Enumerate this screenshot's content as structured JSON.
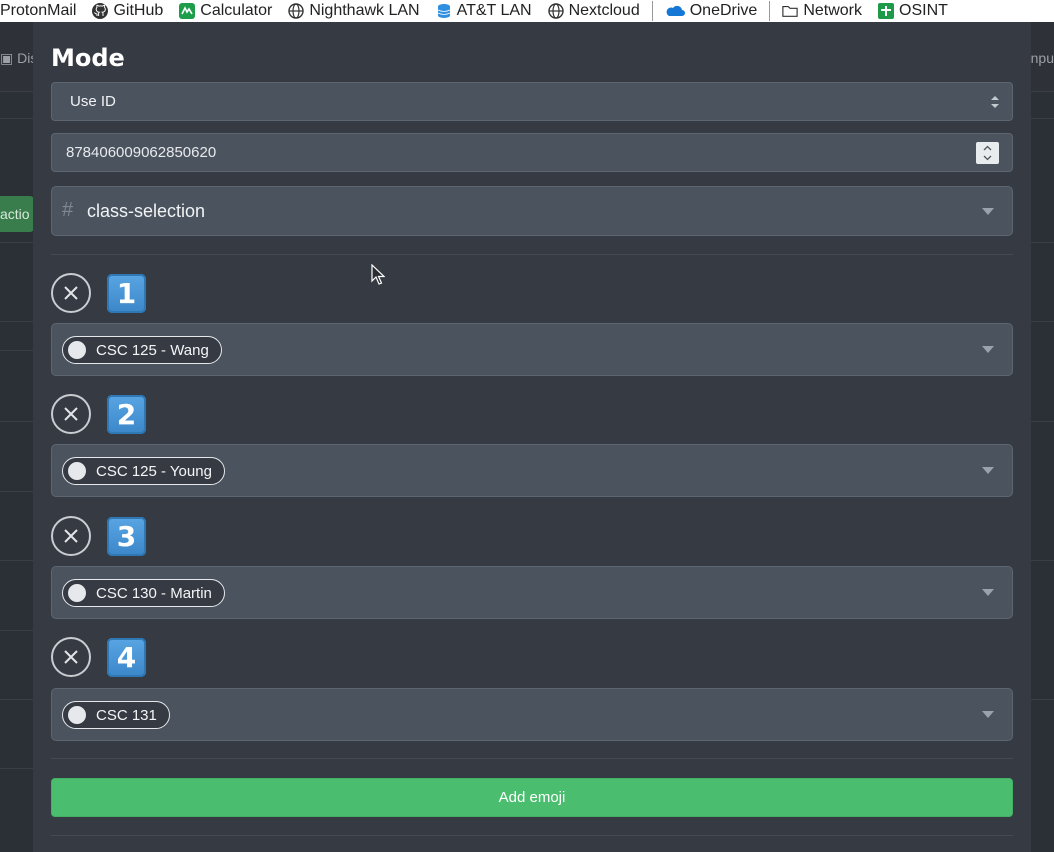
{
  "bookmarks": [
    {
      "label": "ProtonMail",
      "icon": "protonmail-icon"
    },
    {
      "label": "GitHub",
      "icon": "github-icon"
    },
    {
      "label": "Calculator",
      "icon": "calculator-icon"
    },
    {
      "label": "Nighthawk LAN",
      "icon": "globe-icon"
    },
    {
      "label": "AT&T LAN",
      "icon": "database-icon"
    },
    {
      "label": "Nextcloud",
      "icon": "globe-icon"
    },
    {
      "label": "OneDrive",
      "icon": "onedrive-icon"
    },
    {
      "label": "Network",
      "icon": "folder-icon"
    },
    {
      "label": "OSINT",
      "icon": "osint-icon"
    }
  ],
  "background": {
    "left_text": "Dis",
    "right_text": "npu",
    "green_button_text": "actio"
  },
  "modal": {
    "title": "Mode",
    "mode_select": {
      "value": "Use ID"
    },
    "id_input": {
      "value": "878406009062850620"
    },
    "channel_select": {
      "value": "class-selection",
      "prefix": "#"
    },
    "rows": [
      {
        "emoji": "1",
        "role": "CSC 125 - Wang"
      },
      {
        "emoji": "2",
        "role": "CSC 125 - Young"
      },
      {
        "emoji": "3",
        "role": "CSC 130 - Martin"
      },
      {
        "emoji": "4",
        "role": "CSC 131"
      }
    ],
    "add_button": "Add emoji"
  },
  "colors": {
    "modal_bg": "#363b43",
    "field_bg": "#4b535e",
    "add_button": "#4abd6e",
    "keycap": "#3a86c8"
  }
}
